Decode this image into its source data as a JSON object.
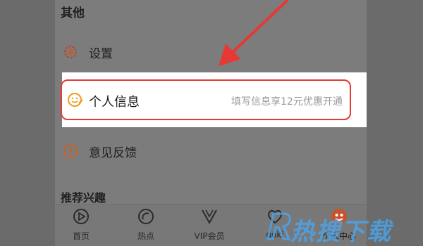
{
  "section": {
    "title": "其他"
  },
  "rows": [
    {
      "label": "设置",
      "icon": "gear-icon"
    },
    {
      "label": "个人信息",
      "icon": "smiley-edit-icon",
      "promo": "填写信息享12元优惠开通"
    },
    {
      "label": "意见反馈",
      "icon": "question-icon"
    }
  ],
  "cut_section": {
    "title": "推荐兴趣"
  },
  "tabs": [
    {
      "label": "首页",
      "icon": "home-play-icon"
    },
    {
      "label": "热点",
      "icon": "hot-icon"
    },
    {
      "label": "VIP会员",
      "icon": "vip-icon"
    },
    {
      "label": "doki",
      "icon": "heart-icon"
    },
    {
      "label": "个人中心",
      "icon": "profile-icon",
      "active": true
    }
  ],
  "colors": {
    "accent": "#e53935",
    "promo_text": "#9a9a9a",
    "watermark": "#49a6f0"
  },
  "watermark": {
    "text": "热搜下载"
  }
}
